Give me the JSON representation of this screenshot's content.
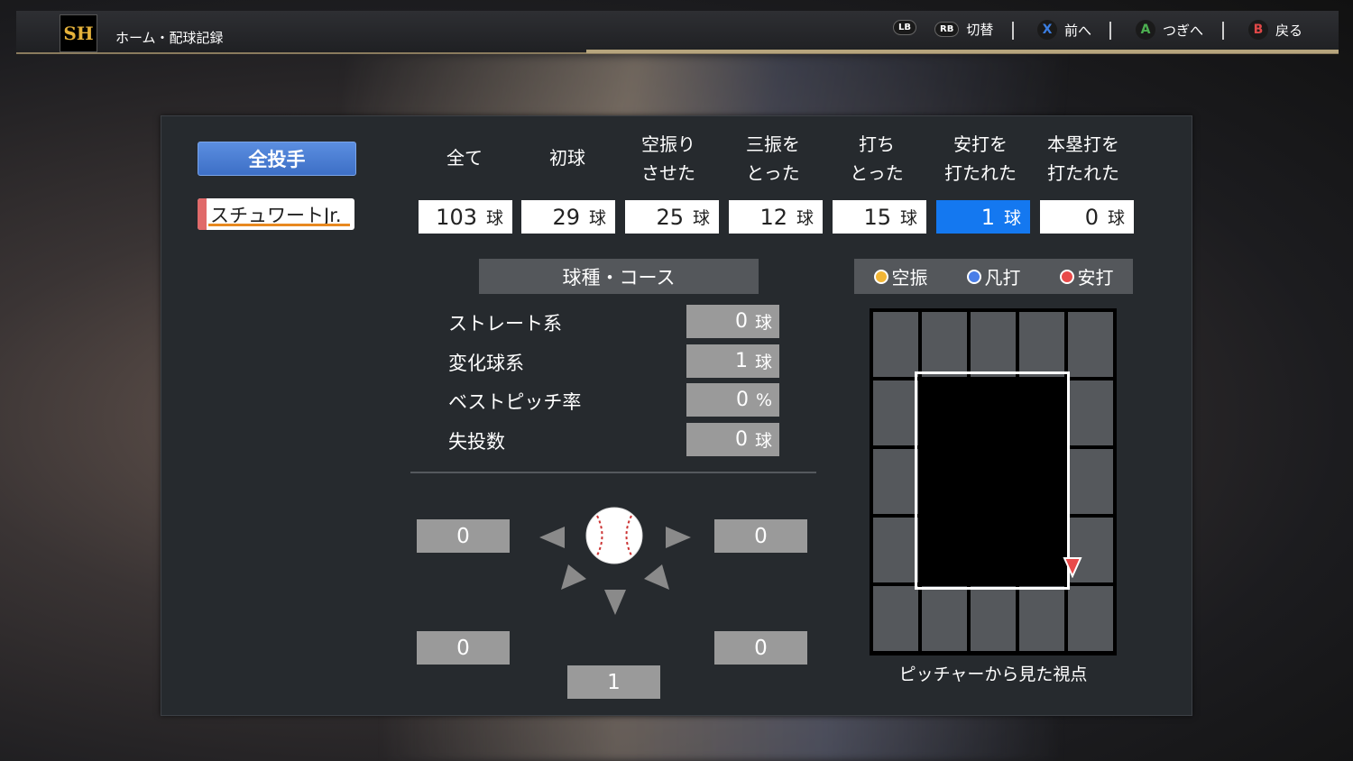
{
  "header": {
    "logo_text": "SH",
    "breadcrumb": "ホーム・配球記録",
    "hints": [
      {
        "button": "LB",
        "label": ""
      },
      {
        "button": "RB",
        "label": "切替"
      },
      {
        "button": "X",
        "label": "前へ",
        "color": "#3b7de0"
      },
      {
        "button": "A",
        "label": "つぎへ",
        "color": "#4caf50"
      },
      {
        "button": "B",
        "label": "戻る",
        "color": "#e04848"
      }
    ]
  },
  "pitchers": {
    "all_label": "全投手",
    "selected_name": "スチュワートJr."
  },
  "categories": [
    {
      "l1": "全て",
      "l2": "",
      "count": "103",
      "unit": "球"
    },
    {
      "l1": "初球",
      "l2": "",
      "count": "29",
      "unit": "球"
    },
    {
      "l1": "空振り",
      "l2": "させた",
      "count": "25",
      "unit": "球"
    },
    {
      "l1": "三振を",
      "l2": "とった",
      "count": "12",
      "unit": "球"
    },
    {
      "l1": "打ち",
      "l2": "とった",
      "count": "15",
      "unit": "球"
    },
    {
      "l1": "安打を",
      "l2": "打たれた",
      "count": "1",
      "unit": "球"
    },
    {
      "l1": "本塁打を",
      "l2": "打たれた",
      "count": "0",
      "unit": "球"
    }
  ],
  "pitch_section": {
    "title": "球種・コース",
    "stats": [
      {
        "label": "ストレート系",
        "value": "0",
        "unit": "球"
      },
      {
        "label": "変化球系",
        "value": "1",
        "unit": "球"
      },
      {
        "label": "ベストピッチ率",
        "value": "0",
        "unit": "%"
      },
      {
        "label": "失投数",
        "value": "0",
        "unit": "球"
      }
    ]
  },
  "directions": {
    "upper_left": "0",
    "upper_right": "0",
    "lower_left": "0",
    "lower_right": "0",
    "bottom": "1"
  },
  "legend": [
    {
      "label": "空振",
      "color": "#f2b636"
    },
    {
      "label": "凡打",
      "color": "#4a7ee8"
    },
    {
      "label": "安打",
      "color": "#e84a4a"
    }
  ],
  "zone": {
    "caption": "ピッチャーから見た視点",
    "marker": "安打"
  }
}
